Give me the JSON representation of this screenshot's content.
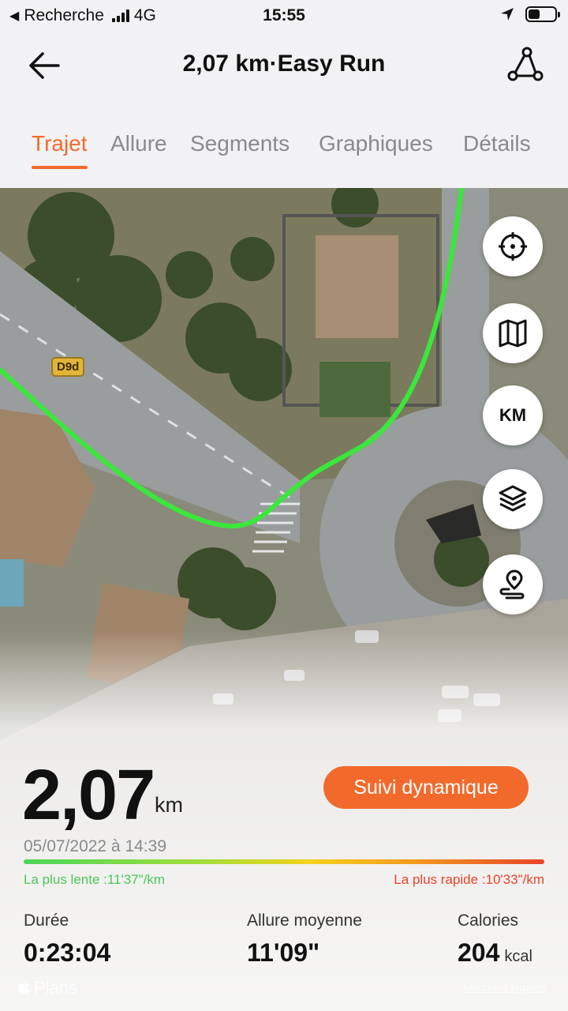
{
  "status_bar": {
    "back_app": "Recherche",
    "network": "4G",
    "time": "15:55"
  },
  "header": {
    "title": "2,07 km·Easy Run"
  },
  "tabs": [
    "Trajet",
    "Allure",
    "Segments",
    "Graphiques",
    "Détails"
  ],
  "active_tab": "Trajet",
  "map": {
    "road_label": "D9d",
    "attribution": "Plans",
    "legal": "Mentions légales",
    "buttons": [
      "locate-icon",
      "map-icon",
      "KM",
      "layers-icon",
      "route-pin-icon"
    ],
    "km_button_label": "KM",
    "route_color": "#39e83a"
  },
  "summary": {
    "distance": "2,07",
    "distance_unit": "km",
    "dynamic_button": "Suivi dynamique",
    "date": "05/07/2022 à 14:39",
    "slowest": "La plus lente :11'37\"/km",
    "fastest": "La plus rapide :10'33\"/km"
  },
  "stats": [
    {
      "label": "Durée",
      "value": "0:23:04",
      "unit": ""
    },
    {
      "label": "Allure moyenne",
      "value": "11'09\"",
      "unit": ""
    },
    {
      "label": "Calories",
      "value": "204",
      "unit": "kcal"
    }
  ],
  "colors": {
    "accent": "#f26a2b",
    "slow": "#4bc75a",
    "fast": "#e8432b"
  }
}
